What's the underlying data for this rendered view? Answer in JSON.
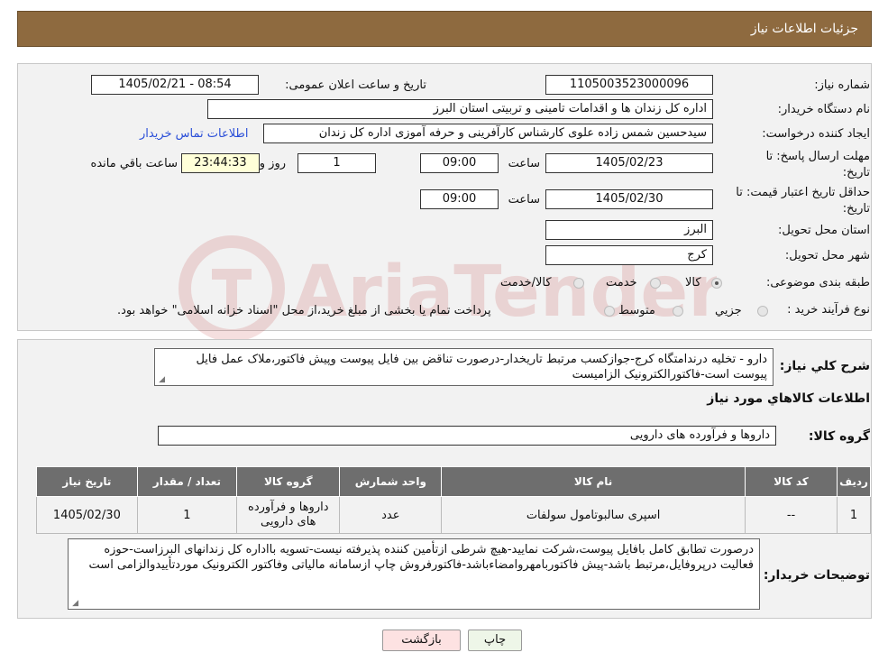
{
  "header": {
    "title": "جزئیات اطلاعات نیاز"
  },
  "info": {
    "need_number_label": "شماره نیاز:",
    "need_number": "1105003523000096",
    "announce_label": "تاریخ و ساعت اعلان عمومی:",
    "announce_value": "1405/02/21 - 08:54",
    "buyer_org_label": "نام دستگاه خریدار:",
    "buyer_org": "اداره کل زندان ها و اقدامات تامینی و تربیتی استان البرز",
    "requester_label": "ایجاد کننده درخواست:",
    "requester": "سیدحسین شمس زاده علوی کارشناس کارآفرینی و حرفه آموزی اداره کل زندان",
    "contact_link": "اطلاعات تماس خریدار",
    "deadline_label_1": "مهلت ارسال پاسخ: تا",
    "deadline_label_2": "تاریخ:",
    "deadline_date": "1405/02/23",
    "time_label": "ساعت",
    "deadline_time": "09:00",
    "days_value": "1",
    "days_label": "روز و",
    "remaining_time": "23:44:33",
    "remaining_label": "ساعت باقي مانده",
    "validity_label_1": "حداقل تاریخ اعتبار قیمت: تا",
    "validity_label_2": "تاریخ:",
    "validity_date": "1405/02/30",
    "validity_time": "09:00",
    "province_label": "استان محل تحویل:",
    "province": "البرز",
    "city_label": "شهر محل تحویل:",
    "city": "کرج",
    "category_label": "طبقه بندی موضوعی:",
    "category_options": [
      "کالا",
      "خدمت",
      "کالا/خدمت"
    ],
    "category_selected": 0,
    "process_label": "نوع فرآیند خرید :",
    "process_options": [
      "جزیي",
      "متوسط"
    ],
    "process_note": "پرداخت تمام یا بخشی از مبلغ خرید،از محل \"اسناد خزانه اسلامی\" خواهد بود."
  },
  "description": {
    "label": "شرح کلي نياز:",
    "text": "دارو - تخلیه درندامتگاه کرج-جوازکسب مرتبط تاریخدار-درصورت تناقض بین فایل پیوست وپیش فاکتور،ملاک عمل فایل پیوست است-فاکتورالکترونیک الزامیست"
  },
  "goods": {
    "section_title": "اطلاعات کالاهاي مورد نياز",
    "group_label": "گروه کالا:",
    "group_value": "داروها و فرآورده های دارویی",
    "columns": [
      "رديف",
      "کد کالا",
      "نام کالا",
      "واحد شمارش",
      "گروه کالا",
      "تعداد / مقدار",
      "تاريخ نياز"
    ],
    "rows": [
      [
        "1",
        "--",
        "اسپری سالبوتامول سولفات",
        "عدد",
        "داروها و فرآورده های دارویی",
        "1",
        "1405/02/30"
      ]
    ]
  },
  "buyer_notes": {
    "label": "توضیحات خریدار:",
    "text": "درصورت تطابق کامل بافایل پیوست،شرکت نمایید-هیچ شرطی ازتأمین کننده پذیرفته نیست-تسویه بااداره کل زندانهای البرزاست-حوزه فعالیت درپروفایل،مرتبط باشد-پیش فاکتوربامهروامضاءباشد-فاکتورفروش چاپ ازسامانه مالیاتی وفاکتور الکترونیک موردتأییدوالزامی است"
  },
  "buttons": {
    "print": "چاپ",
    "back": "بازگشت"
  },
  "watermark_text": "AriaTender.neT",
  "colors": {
    "header": "#8e6a3f",
    "table_header": "#6e6e6e",
    "link": "#2b4fd8",
    "remaining_bg": "#ffffd8"
  }
}
